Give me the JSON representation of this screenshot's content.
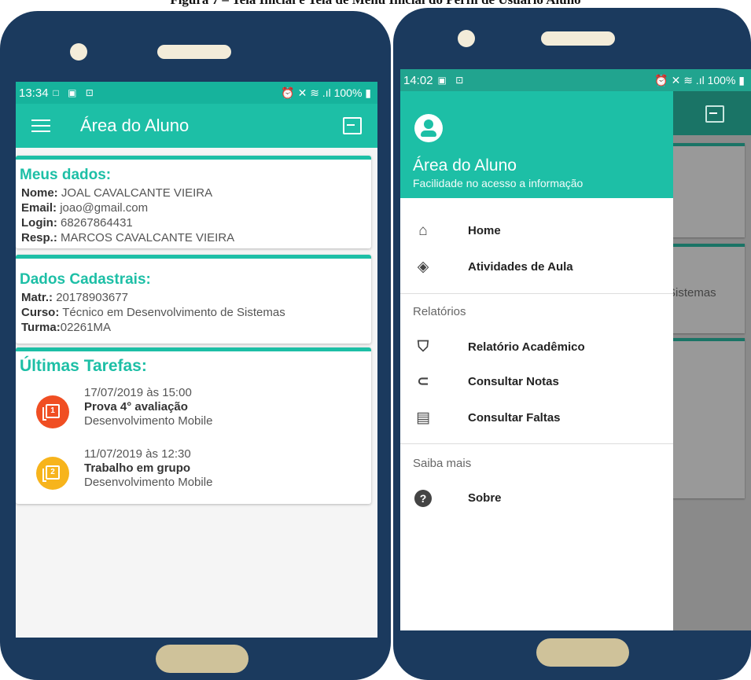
{
  "caption": "Figura 7 – Tela Inicial e Tela de Menu Inicial do Perfil de Usuário Aluno",
  "phone1": {
    "status": {
      "time": "13:34",
      "left_icons": "□ ▣ ⊡",
      "right": "⏰ ✕ ≋ .ıl 100% ▮"
    },
    "appbar": {
      "title": "Área do Aluno"
    },
    "meus_dados": {
      "title": "Meus dados:",
      "nome_label": "Nome:",
      "nome": "JOAL CAVALCANTE VIEIRA",
      "email_label": "Email:",
      "email": "joao@gmail.com",
      "login_label": "Login:",
      "login": "68267864431",
      "resp_label": "Resp.:",
      "resp": "MARCOS CAVALCANTE VIEIRA"
    },
    "dados_cadastrais": {
      "title": "Dados Cadastrais:",
      "matr_label": "Matr.:",
      "matr": "20178903677",
      "curso_label": "Curso:",
      "curso": "Técnico em Desenvolvimento de Sistemas",
      "turma_label": "Turma:",
      "turma": "02261MA"
    },
    "tarefas": {
      "title": "Últimas Tarefas:",
      "items": [
        {
          "date": "17/07/2019 às 15:00",
          "name": "Prova 4° avaliação",
          "subject": "Desenvolvimento Mobile",
          "num": "1",
          "color": "#f04e23"
        },
        {
          "date": "11/07/2019 às 12:30",
          "name": "Trabalho em grupo",
          "subject": "Desenvolvimento Mobile",
          "num": "2",
          "color": "#f7b41c"
        }
      ]
    }
  },
  "phone2": {
    "status": {
      "time": "14:02",
      "left_icons": "▣ ⊡",
      "right": "⏰ ✕ ≋ .ıl 100% ▮"
    },
    "behind_text": "Sistemas",
    "drawer": {
      "title": "Área do Aluno",
      "subtitle": "Facilidade no acesso a informação",
      "items": [
        {
          "label": "Home",
          "icon": "home-icon"
        },
        {
          "label": "Atividades de Aula",
          "icon": "class-icon"
        }
      ],
      "section1": "Relatórios",
      "report_items": [
        {
          "label": "Relatório Acadêmico",
          "icon": "school-icon"
        },
        {
          "label": "Consultar Notas",
          "icon": "attachment-icon"
        },
        {
          "label": "Consultar Faltas",
          "icon": "clipboard-icon"
        }
      ],
      "section2": "Saiba mais",
      "about": {
        "label": "Sobre",
        "icon": "help-icon"
      }
    }
  }
}
